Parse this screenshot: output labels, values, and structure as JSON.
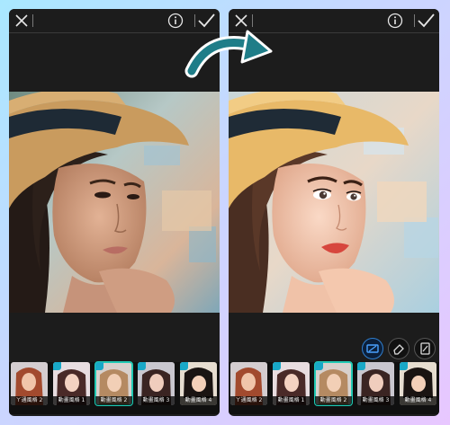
{
  "colors": {
    "accent": "#21c9b3",
    "panel_bg": "#1c1c1c",
    "arrow": "#1f7d88"
  },
  "topbar": {
    "close_icon": "close-icon",
    "info_icon": "info-icon",
    "confirm_icon": "check-icon"
  },
  "filters": {
    "items": [
      {
        "label": "ㄚ通風格 2"
      },
      {
        "label": "動畫風格 1"
      },
      {
        "label": "動畫風格 2"
      },
      {
        "label": "動畫風格 3"
      },
      {
        "label": "動畫風格 4"
      }
    ],
    "selected_index": 2
  },
  "tools": [
    "style-icon",
    "eraser-icon",
    "compare-icon"
  ]
}
